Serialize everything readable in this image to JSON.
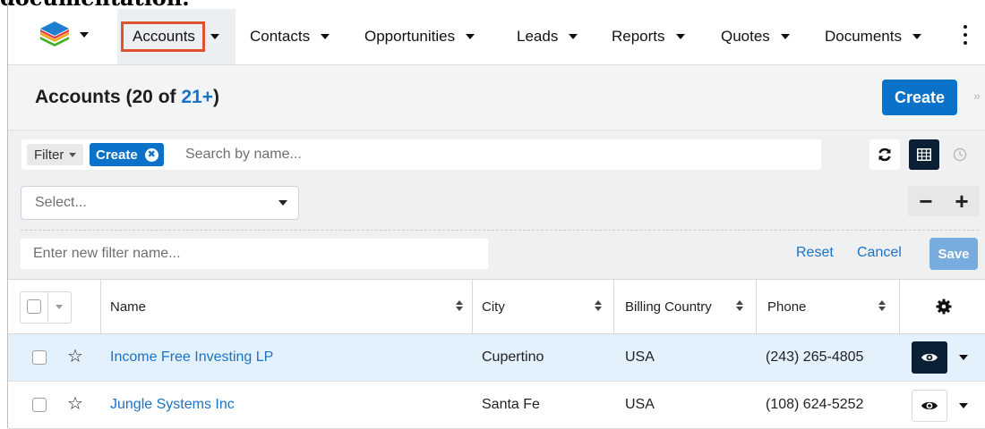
{
  "caption": "documentation.",
  "nav": {
    "items": [
      {
        "label": "Accounts"
      },
      {
        "label": "Contacts"
      },
      {
        "label": "Opportunities"
      },
      {
        "label": "Leads"
      },
      {
        "label": "Reports"
      },
      {
        "label": "Quotes"
      },
      {
        "label": "Documents"
      }
    ],
    "active": "Accounts"
  },
  "header": {
    "title_prefix": "Accounts (20 of ",
    "count_link": "21+",
    "title_suffix": ")",
    "create_label": "Create",
    "collapse_icon": "»"
  },
  "filter": {
    "dropdown_label": "Filter",
    "pill_label": "Create",
    "pill_close": "✖",
    "search_placeholder": "Search by name...",
    "field_select_placeholder": "Select...",
    "name_placeholder": "Enter new filter name...",
    "reset_label": "Reset",
    "cancel_label": "Cancel",
    "save_label": "Save",
    "minus": "−",
    "plus": "+"
  },
  "table": {
    "columns": [
      "Name",
      "City",
      "Billing Country",
      "Phone"
    ],
    "rows": [
      {
        "name": "Income Free Investing LP",
        "city": "Cupertino",
        "country": "USA",
        "phone": "(243) 265-4805",
        "selected": true
      },
      {
        "name": "Jungle Systems Inc",
        "city": "Santa Fe",
        "country": "USA",
        "phone": "(108) 624-5252",
        "selected": false
      }
    ]
  },
  "colors": {
    "accent": "#0a72c9",
    "highlight_box": "#e0522c",
    "dark_button": "#0b2035",
    "selected_row": "#e3f1fc"
  }
}
